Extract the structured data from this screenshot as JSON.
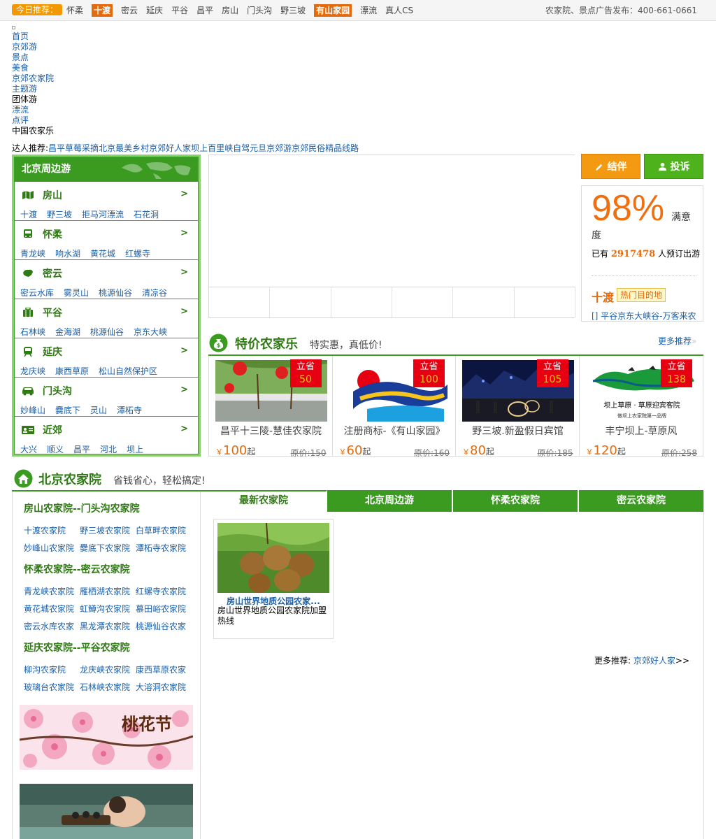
{
  "topbar": {
    "today_label": "今日推荐：",
    "links": [
      {
        "label": "怀柔",
        "highlight": false
      },
      {
        "label": "十渡",
        "highlight": true
      },
      {
        "label": "密云",
        "highlight": false
      },
      {
        "label": "延庆",
        "highlight": false
      },
      {
        "label": "平谷",
        "highlight": false
      },
      {
        "label": "昌平",
        "highlight": false
      },
      {
        "label": "房山",
        "highlight": false
      },
      {
        "label": "门头沟",
        "highlight": false
      },
      {
        "label": "野三坡",
        "highlight": false
      },
      {
        "label": "有山家园",
        "highlight": true
      },
      {
        "label": "漂流",
        "highlight": false
      },
      {
        "label": "真人CS",
        "highlight": false
      }
    ],
    "ad_phone": "农家院、景点广告发布：400-661-0661"
  },
  "nav": {
    "items": [
      {
        "label": "首页",
        "link": true
      },
      {
        "label": "京郊游",
        "link": true
      },
      {
        "label": "景点",
        "link": true
      },
      {
        "label": "美食",
        "link": true
      },
      {
        "label": "京郊农家院",
        "link": true
      },
      {
        "label": "主题游",
        "link": true
      },
      {
        "label": "团体游",
        "link": false
      },
      {
        "label": "漂流",
        "link": true
      },
      {
        "label": "点评",
        "link": true
      },
      {
        "label": "中国农家乐",
        "link": false
      }
    ],
    "expert_label": "达人推荐:",
    "expert_links": [
      "昌平草莓采摘",
      "北京最美乡村",
      "京郊好人家",
      "坝上",
      "百里峡自驾",
      "元旦京郊游",
      "京郊民俗精品线路"
    ]
  },
  "around": {
    "title": "北京周边游",
    "regions": [
      {
        "name": "房山",
        "icon": "map-icon",
        "links": [
          "十渡",
          "野三坡",
          "拒马河漂流",
          "石花洞"
        ]
      },
      {
        "name": "怀柔",
        "icon": "bus-icon",
        "links": [
          "青龙峡",
          "响水湖",
          "黄花城",
          "红螺寺"
        ]
      },
      {
        "name": "密云",
        "icon": "china-map-icon",
        "links": [
          "密云水库",
          "雾灵山",
          "桃源仙谷",
          "清凉谷"
        ]
      },
      {
        "name": "平谷",
        "icon": "luggage-icon",
        "links": [
          "石林峡",
          "金海湖",
          "桃源仙谷",
          "京东大峡"
        ]
      },
      {
        "name": "延庆",
        "icon": "train-icon",
        "links": [
          "龙庆峡",
          "康西草原",
          "松山自然保护区"
        ]
      },
      {
        "name": "门头沟",
        "icon": "car-icon",
        "links": [
          "妙峰山",
          "爨底下",
          "灵山",
          "潭柘寺"
        ]
      },
      {
        "name": "近郊",
        "icon": "id-card-icon",
        "links": [
          "大兴",
          "顺义",
          "昌平",
          "河北",
          "坝上"
        ]
      }
    ],
    "arrow": ">"
  },
  "actions": {
    "partner": "结伴",
    "complain": "投诉"
  },
  "satisfaction": {
    "percent": "98%",
    "label_a": "满意",
    "label_b": "度",
    "booked_prefix": "已有",
    "booked_count": "2917478",
    "booked_suffix": "人预订出游",
    "hot_name": "十渡",
    "hot_tag": "热门目的地",
    "news": "[] 平谷京东大峡谷-万客来农"
  },
  "deals": {
    "title": "特价农家乐",
    "subtitle": "特实惠，真低价!",
    "more": "更多推荐",
    "more_arrow": "»",
    "save_label": "立省",
    "price_prefix": "￥",
    "price_suffix": "起",
    "items": [
      {
        "name": "昌平十三陵-慧佳农家院",
        "save": "50",
        "price": "100",
        "orig": "原价:150"
      },
      {
        "name": "注册商标-《有山家园》",
        "save": "100",
        "price": "60",
        "orig": "原价:160"
      },
      {
        "name": "野三坡.新盈假日宾馆",
        "save": "105",
        "price": "80",
        "orig": "原价:185"
      },
      {
        "name": "丰宁坝上-草原风",
        "save": "138",
        "price": "120",
        "orig": "原价:258"
      }
    ]
  },
  "farmhouse": {
    "title": "北京农家院",
    "subtitle": "省钱省心，轻松搞定!",
    "groups": [
      {
        "title": "房山农家院--门头沟农家院",
        "links": [
          "十渡农家院",
          "野三坡农家院",
          "白草畔农家院",
          "妙峰山农家院",
          "爨底下农家院",
          "潭柘寺农家院"
        ]
      },
      {
        "title": "怀柔农家院--密云农家院",
        "links": [
          "青龙峡农家院",
          "雁栖湖农家院",
          "红螺寺农家院",
          "黄花城农家院",
          "虹鳟沟农家院",
          "慕田峪农家院",
          "密云水库农家",
          "黑龙潭农家院",
          "桃源仙谷农家"
        ]
      },
      {
        "title": "延庆农家院--平谷农家院",
        "links": [
          "柳沟农家院",
          "龙庆峡农家院",
          "康西草原农家",
          "玻璃台农家院",
          "石林峡农家院",
          "大溶洞农家院"
        ]
      }
    ],
    "ad_peach": "桃花节",
    "tabs": [
      "最新农家院",
      "北京周边游",
      "怀柔农家院",
      "密云农家院"
    ],
    "card": {
      "title": "房山世界地质公园农家...",
      "desc": "房山世界地质公园农家院加盟热线"
    },
    "more_label": "更多推荐:",
    "more_link": "京郊好人家",
    "more_arrow": ">>"
  },
  "colors": {
    "brand_green": "#3a9b20",
    "accent_orange": "#f39800",
    "price_orange": "#e56a0c",
    "save_red": "#e60012"
  }
}
